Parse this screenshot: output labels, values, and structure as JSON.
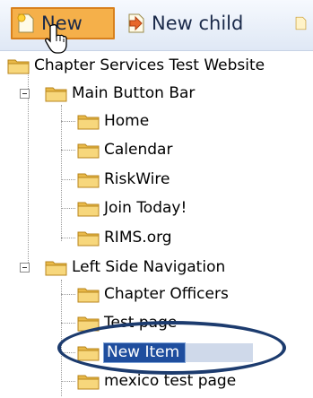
{
  "toolbar": {
    "new_label": "New",
    "new_child_label": "New child"
  },
  "tree": {
    "root": "Chapter Services Test Website",
    "groups": [
      {
        "label": "Main Button Bar",
        "children": [
          "Home",
          "Calendar",
          "RiskWire",
          "Join Today!",
          "RIMS.org"
        ]
      },
      {
        "label": "Left Side Navigation",
        "children": [
          "Chapter Officers",
          "Test page",
          "New Item",
          "mexico test page"
        ]
      }
    ],
    "editing_item": "New Item"
  },
  "colors": {
    "toolbar_active_bg": "#f5b04a",
    "selection_bg": "#1f4e9e",
    "annotation_oval": "#1c3b6e"
  }
}
